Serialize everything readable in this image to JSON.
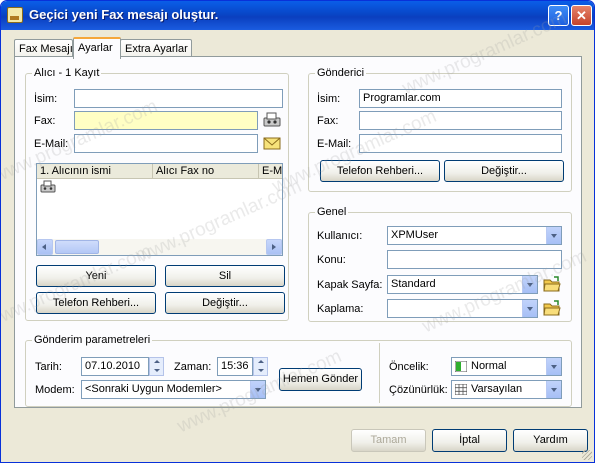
{
  "window": {
    "title": "Geçici yeni Fax mesajı oluştur.",
    "help_btn": "?",
    "close_btn": "✕"
  },
  "tabs": [
    "Fax Mesajı",
    "Ayarlar",
    "Extra Ayarlar"
  ],
  "recipient": {
    "group_label": "Alıcı - 1 Kayıt",
    "name_label": "İsim:",
    "name_value": "",
    "fax_label": "Fax:",
    "fax_value": "",
    "email_label": "E-Mail:",
    "email_value": "",
    "list_columns": [
      "1. Alıcının ismi",
      "Alıcı Fax no",
      "E-Ma"
    ],
    "new_btn": "Yeni",
    "delete_btn": "Sil",
    "phonebook_btn": "Telefon Rehberi...",
    "change_btn": "Değiştir..."
  },
  "sender": {
    "group_label": "Gönderici",
    "name_label": "İsim:",
    "name_value": "Programlar.com",
    "fax_label": "Fax:",
    "fax_value": "",
    "email_label": "E-Mail:",
    "email_value": "",
    "phonebook_btn": "Telefon Rehberi...",
    "change_btn": "Değiştir..."
  },
  "general": {
    "group_label": "Genel",
    "user_label": "Kullanıcı:",
    "user_value": "XPMUser",
    "subject_label": "Konu:",
    "subject_value": "",
    "cover_label": "Kapak Sayfa:",
    "cover_value": "Standard",
    "overlay_label": "Kaplama:",
    "overlay_value": ""
  },
  "params": {
    "group_label": "Gönderim parametreleri",
    "date_label": "Tarih:",
    "date_value": "07.10.2010",
    "time_label": "Zaman:",
    "time_value": "15:36",
    "modem_label": "Modem:",
    "modem_value": "<Sonraki Uygun Modemler>",
    "send_now_btn": "Hemen Gönder",
    "priority_label": "Öncelik:",
    "priority_value": "Normal",
    "resolution_label": "Çözünürlük:",
    "resolution_value": "Varsayılan"
  },
  "footer": {
    "ok_btn": "Tamam",
    "cancel_btn": "İptal",
    "help_btn": "Yardım"
  },
  "watermark": "www.programlar.com",
  "colors": {
    "titlebar": "#0a4fd6",
    "window_bg": "#ece9d8",
    "panel_bg": "#fcfcfe",
    "fax_field_bg": "#ffffc4",
    "active_tab_accent": "#f5a73b"
  }
}
